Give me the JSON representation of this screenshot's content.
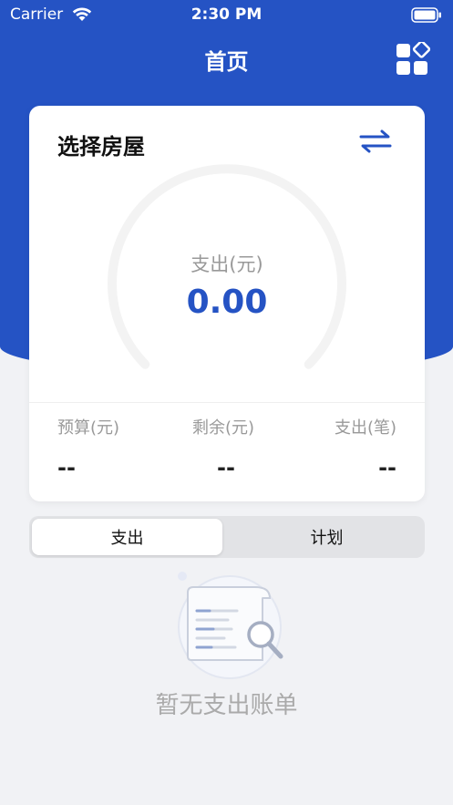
{
  "status_bar": {
    "carrier": "Carrier",
    "time": "2:30 PM"
  },
  "nav": {
    "title": "首页"
  },
  "card": {
    "title": "选择房屋",
    "gauge_label": "支出(元)",
    "gauge_value": "0.00",
    "stats": [
      {
        "label": "预算(元)",
        "value": "--"
      },
      {
        "label": "剩余(元)",
        "value": "--"
      },
      {
        "label": "支出(笔)",
        "value": "--"
      }
    ]
  },
  "tabs": [
    {
      "label": "支出",
      "active": true
    },
    {
      "label": "计划",
      "active": false
    }
  ],
  "empty_state": {
    "text": "暂无支出账单"
  },
  "colors": {
    "primary": "#2553c4",
    "background": "#f1f2f5",
    "gauge_track": "#f3f3f3"
  }
}
